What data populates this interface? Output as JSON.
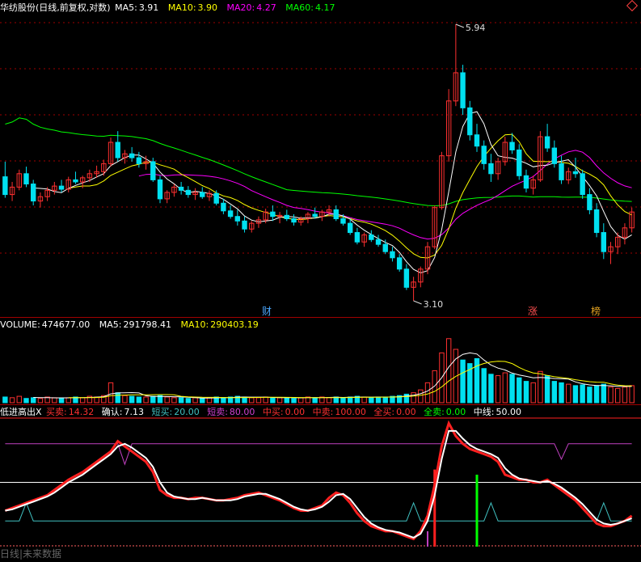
{
  "header_main": {
    "title": "华纺股份(日线,前复权,对数)",
    "ma5_label": "MA5:",
    "ma5_value": "3.91",
    "ma10_label": "MA10:",
    "ma10_value": "3.90",
    "ma20_label": "MA20:",
    "ma20_value": "4.27",
    "ma60_label": "MA60:",
    "ma60_value": "4.17"
  },
  "header_volume": {
    "volume_label": "VOLUME:",
    "volume_value": "474677.00",
    "ma5_label": "MA5:",
    "ma5_value": "291798.41",
    "ma10_label": "MA10:",
    "ma10_value": "290403.19"
  },
  "header_indicator": {
    "name": "低进高出X",
    "buy_label": "买卖:",
    "buy_value": "14.32",
    "confirm_label": "确认:",
    "confirm_value": "7.13",
    "short_buy_label": "短买:",
    "short_buy_value": "20.00",
    "short_sell_label": "短卖:",
    "short_sell_value": "80.00",
    "mid_buy_label": "中买:",
    "mid_buy_value": "0.00",
    "mid_sell_label": "中卖:",
    "mid_sell_value": "100.00",
    "all_buy_label": "全买:",
    "all_buy_value": "0.00",
    "all_sell_label": "全卖:",
    "all_sell_value": "0.00",
    "midline_label": "中线:",
    "midline_value": "50.00"
  },
  "annotations": {
    "high_label": "5.94",
    "low_label": "3.10"
  },
  "event_tags": [
    {
      "text": "财",
      "color": "#4aa8ff"
    },
    {
      "text": "涨",
      "color": "#ff5050"
    },
    {
      "text": "榜",
      "color": "#e0a020"
    }
  ],
  "bottom_tab": "日线|未来数据",
  "colors": {
    "up": "#ff3030",
    "down": "#00e0f0",
    "ma5": "#ffffff",
    "ma10": "#ffff00",
    "ma20": "#ff00ff",
    "ma60": "#00ff00",
    "grid": "#a00000",
    "buysell": "#ff2020",
    "confirm": "#ffffff",
    "short_buy": "#40c0c0",
    "short_sell": "#c040c0"
  },
  "chart_data": {
    "type": "candlestick",
    "price_range": [
      3.1,
      5.94
    ],
    "scale": "log",
    "bars": [
      [
        4.15,
        4.3,
        3.95,
        3.98
      ],
      [
        3.98,
        4.1,
        3.92,
        4.05
      ],
      [
        4.05,
        4.22,
        4.02,
        4.18
      ],
      [
        4.18,
        4.25,
        4.05,
        4.08
      ],
      [
        4.08,
        4.12,
        3.88,
        3.92
      ],
      [
        3.92,
        4.0,
        3.86,
        3.96
      ],
      [
        3.96,
        4.05,
        3.92,
        4.02
      ],
      [
        4.02,
        4.1,
        3.98,
        4.06
      ],
      [
        4.06,
        4.12,
        4.0,
        4.03
      ],
      [
        4.03,
        4.15,
        4.0,
        4.12
      ],
      [
        4.12,
        4.2,
        4.08,
        4.1
      ],
      [
        4.1,
        4.16,
        4.04,
        4.14
      ],
      [
        4.14,
        4.22,
        4.1,
        4.18
      ],
      [
        4.18,
        4.26,
        4.14,
        4.2
      ],
      [
        4.2,
        4.32,
        4.16,
        4.28
      ],
      [
        4.28,
        4.55,
        4.25,
        4.5
      ],
      [
        4.5,
        4.62,
        4.3,
        4.34
      ],
      [
        4.34,
        4.42,
        4.28,
        4.38
      ],
      [
        4.38,
        4.45,
        4.3,
        4.34
      ],
      [
        4.34,
        4.4,
        4.24,
        4.28
      ],
      [
        4.28,
        4.36,
        4.22,
        4.3
      ],
      [
        4.3,
        4.34,
        4.1,
        4.12
      ],
      [
        4.12,
        4.16,
        3.9,
        3.94
      ],
      [
        3.94,
        4.02,
        3.9,
        4.0
      ],
      [
        4.0,
        4.08,
        3.96,
        4.05
      ],
      [
        4.05,
        4.1,
        3.98,
        4.02
      ],
      [
        4.02,
        4.06,
        3.95,
        3.98
      ],
      [
        3.98,
        4.04,
        3.93,
        4.0
      ],
      [
        4.0,
        4.05,
        3.94,
        3.96
      ],
      [
        3.96,
        4.02,
        3.92,
        3.99
      ],
      [
        3.99,
        4.02,
        3.88,
        3.9
      ],
      [
        3.9,
        3.94,
        3.8,
        3.83
      ],
      [
        3.83,
        3.88,
        3.76,
        3.78
      ],
      [
        3.78,
        3.84,
        3.7,
        3.74
      ],
      [
        3.74,
        3.78,
        3.64,
        3.67
      ],
      [
        3.67,
        3.74,
        3.64,
        3.72
      ],
      [
        3.72,
        3.78,
        3.68,
        3.75
      ],
      [
        3.75,
        3.85,
        3.72,
        3.82
      ],
      [
        3.82,
        3.88,
        3.74,
        3.78
      ],
      [
        3.78,
        3.82,
        3.72,
        3.79
      ],
      [
        3.79,
        3.84,
        3.74,
        3.76
      ],
      [
        3.76,
        3.8,
        3.7,
        3.73
      ],
      [
        3.73,
        3.78,
        3.7,
        3.76
      ],
      [
        3.76,
        3.82,
        3.72,
        3.8
      ],
      [
        3.8,
        3.86,
        3.76,
        3.78
      ],
      [
        3.78,
        3.84,
        3.74,
        3.82
      ],
      [
        3.82,
        3.88,
        3.78,
        3.84
      ],
      [
        3.84,
        3.88,
        3.74,
        3.76
      ],
      [
        3.76,
        3.8,
        3.7,
        3.72
      ],
      [
        3.72,
        3.76,
        3.62,
        3.64
      ],
      [
        3.64,
        3.68,
        3.54,
        3.56
      ],
      [
        3.56,
        3.64,
        3.52,
        3.62
      ],
      [
        3.62,
        3.66,
        3.56,
        3.58
      ],
      [
        3.58,
        3.62,
        3.52,
        3.54
      ],
      [
        3.54,
        3.58,
        3.46,
        3.48
      ],
      [
        3.48,
        3.52,
        3.4,
        3.43
      ],
      [
        3.43,
        3.46,
        3.32,
        3.34
      ],
      [
        3.34,
        3.38,
        3.18,
        3.2
      ],
      [
        3.2,
        3.28,
        3.1,
        3.24
      ],
      [
        3.24,
        3.36,
        3.2,
        3.34
      ],
      [
        3.34,
        3.56,
        3.3,
        3.52
      ],
      [
        3.52,
        3.88,
        3.5,
        3.86
      ],
      [
        3.86,
        4.4,
        3.84,
        4.36
      ],
      [
        4.36,
        5.1,
        4.3,
        4.96
      ],
      [
        4.96,
        5.94,
        4.9,
        5.3
      ],
      [
        5.3,
        5.4,
        4.8,
        4.88
      ],
      [
        4.88,
        4.96,
        4.52,
        4.58
      ],
      [
        4.58,
        4.7,
        4.4,
        4.46
      ],
      [
        4.46,
        4.52,
        4.22,
        4.28
      ],
      [
        4.28,
        4.38,
        4.1,
        4.18
      ],
      [
        4.18,
        4.34,
        4.12,
        4.3
      ],
      [
        4.3,
        4.56,
        4.26,
        4.5
      ],
      [
        4.5,
        4.6,
        4.38,
        4.42
      ],
      [
        4.42,
        4.48,
        4.12,
        4.16
      ],
      [
        4.16,
        4.22,
        4.0,
        4.04
      ],
      [
        4.04,
        4.16,
        3.98,
        4.12
      ],
      [
        4.12,
        4.62,
        4.1,
        4.56
      ],
      [
        4.56,
        4.7,
        4.4,
        4.44
      ],
      [
        4.44,
        4.52,
        4.24,
        4.28
      ],
      [
        4.28,
        4.36,
        4.08,
        4.12
      ],
      [
        4.12,
        4.24,
        4.08,
        4.2
      ],
      [
        4.2,
        4.34,
        4.14,
        4.18
      ],
      [
        4.18,
        4.22,
        3.94,
        3.98
      ],
      [
        3.98,
        4.04,
        3.8,
        3.84
      ],
      [
        3.84,
        3.9,
        3.6,
        3.64
      ],
      [
        3.64,
        3.72,
        3.42,
        3.48
      ],
      [
        3.48,
        3.56,
        3.38,
        3.52
      ],
      [
        3.52,
        3.64,
        3.46,
        3.6
      ],
      [
        3.6,
        3.72,
        3.54,
        3.68
      ],
      [
        3.68,
        3.86,
        3.64,
        3.82
      ]
    ],
    "volume": [
      8,
      7,
      9,
      6,
      7,
      6,
      8,
      7,
      6,
      7,
      8,
      7,
      9,
      8,
      10,
      28,
      14,
      10,
      9,
      8,
      8,
      9,
      10,
      8,
      7,
      7,
      6,
      7,
      6,
      7,
      8,
      7,
      8,
      9,
      8,
      7,
      7,
      8,
      7,
      7,
      7,
      6,
      7,
      8,
      7,
      8,
      7,
      8,
      7,
      8,
      9,
      8,
      7,
      8,
      8,
      9,
      10,
      12,
      14,
      18,
      28,
      45,
      70,
      90,
      75,
      60,
      55,
      62,
      48,
      40,
      38,
      42,
      40,
      35,
      30,
      28,
      44,
      38,
      30,
      28,
      26,
      24,
      25,
      22,
      24,
      26,
      22,
      20,
      22,
      24
    ],
    "volume_ylim": [
      0,
      100
    ],
    "indicator": {
      "buysell": [
        28,
        30,
        32,
        34,
        36,
        38,
        40,
        44,
        48,
        52,
        55,
        58,
        62,
        66,
        70,
        74,
        82,
        78,
        74,
        70,
        66,
        58,
        44,
        40,
        38,
        38,
        37,
        38,
        38,
        37,
        36,
        36,
        37,
        38,
        40,
        41,
        42,
        40,
        38,
        36,
        33,
        30,
        28,
        28,
        30,
        32,
        38,
        42,
        40,
        34,
        26,
        20,
        16,
        14,
        12,
        12,
        10,
        8,
        6,
        12,
        24,
        48,
        78,
        96,
        86,
        80,
        76,
        74,
        72,
        70,
        66,
        56,
        54,
        52,
        52,
        50,
        50,
        52,
        48,
        44,
        40,
        36,
        30,
        24,
        18,
        16,
        16,
        18,
        20,
        24
      ],
      "confirm": [
        28,
        29,
        31,
        33,
        35,
        37,
        39,
        42,
        46,
        50,
        53,
        56,
        60,
        64,
        68,
        72,
        78,
        80,
        77,
        73,
        69,
        62,
        50,
        42,
        39,
        38,
        37,
        37,
        38,
        37,
        36,
        36,
        36,
        37,
        39,
        40,
        41,
        41,
        39,
        37,
        34,
        31,
        29,
        28,
        29,
        31,
        35,
        40,
        41,
        37,
        30,
        23,
        18,
        15,
        13,
        12,
        11,
        9,
        7,
        10,
        20,
        40,
        68,
        90,
        90,
        84,
        79,
        76,
        74,
        72,
        69,
        61,
        56,
        53,
        52,
        51,
        50,
        51,
        49,
        46,
        42,
        38,
        33,
        27,
        21,
        18,
        17,
        18,
        20,
        22
      ],
      "short_buy": [
        20,
        20,
        20,
        34,
        20,
        20,
        20,
        20,
        20,
        20,
        20,
        20,
        20,
        20,
        20,
        20,
        20,
        20,
        20,
        20,
        20,
        20,
        20,
        20,
        20,
        20,
        20,
        20,
        20,
        20,
        20,
        20,
        20,
        20,
        20,
        20,
        20,
        20,
        20,
        20,
        20,
        20,
        20,
        20,
        20,
        20,
        20,
        20,
        20,
        20,
        20,
        20,
        20,
        20,
        20,
        20,
        20,
        20,
        34,
        20,
        20,
        20,
        20,
        20,
        20,
        20,
        20,
        20,
        20,
        34,
        20,
        20,
        20,
        20,
        20,
        20,
        20,
        20,
        20,
        20,
        20,
        20,
        20,
        20,
        20,
        34,
        20,
        20,
        20,
        20
      ],
      "short_sell": [
        80,
        80,
        80,
        80,
        80,
        80,
        80,
        80,
        80,
        80,
        80,
        80,
        80,
        80,
        80,
        80,
        80,
        64,
        80,
        80,
        80,
        80,
        80,
        80,
        80,
        80,
        80,
        80,
        80,
        80,
        80,
        80,
        80,
        80,
        80,
        80,
        80,
        80,
        80,
        80,
        80,
        80,
        80,
        80,
        80,
        80,
        80,
        80,
        80,
        80,
        80,
        80,
        80,
        80,
        80,
        80,
        80,
        80,
        80,
        80,
        80,
        80,
        80,
        80,
        80,
        80,
        80,
        80,
        80,
        80,
        80,
        80,
        80,
        80,
        80,
        80,
        80,
        80,
        80,
        68,
        80,
        80,
        80,
        80,
        80,
        80,
        80,
        80,
        80,
        80
      ],
      "mid_sell": 100,
      "midline": 50,
      "ylim": [
        0,
        100
      ]
    }
  }
}
